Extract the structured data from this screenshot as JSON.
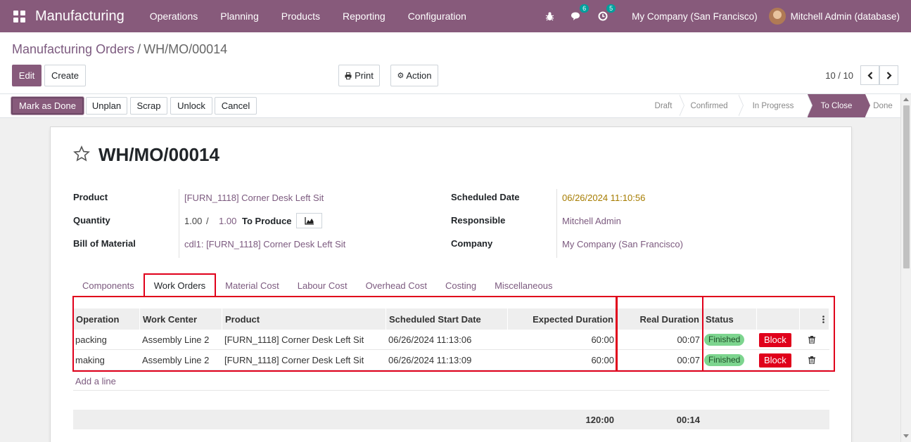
{
  "navbar": {
    "app_name": "Manufacturing",
    "menu": [
      "Operations",
      "Planning",
      "Products",
      "Reporting",
      "Configuration"
    ],
    "messages_count": "6",
    "activities_count": "5",
    "company": "My Company (San Francisco)",
    "user": "Mitchell Admin (database)",
    "colors": {
      "brand": "#875a7b"
    }
  },
  "breadcrumb": {
    "parent": "Manufacturing Orders",
    "separator": "/",
    "current": "WH/MO/00014"
  },
  "toolbar": {
    "edit": "Edit",
    "create": "Create",
    "print": "Print",
    "action": "Action"
  },
  "pager": {
    "text": "10 / 10"
  },
  "statusbar": {
    "buttons": [
      "Mark as Done",
      "Unplan",
      "Scrap",
      "Unlock",
      "Cancel"
    ],
    "stages": [
      "Draft",
      "Confirmed",
      "In Progress",
      "To Close",
      "Done"
    ],
    "active_stage": "To Close"
  },
  "form": {
    "title": "WH/MO/00014",
    "product_label": "Product",
    "product": "[FURN_1118] Corner Desk Left Sit",
    "quantity_label": "Quantity",
    "qty_produced": "1.00",
    "qty_sep": "/",
    "qty_total": "1.00",
    "qty_suffix": "To Produce",
    "bom_label": "Bill of Material",
    "bom": "cdl1: [FURN_1118] Corner Desk Left Sit",
    "scheduled_label": "Scheduled Date",
    "scheduled": "06/26/2024 11:10:56",
    "responsible_label": "Responsible",
    "responsible": "Mitchell Admin",
    "company_label": "Company",
    "company": "My Company (San Francisco)"
  },
  "tabs": [
    "Components",
    "Work Orders",
    "Material Cost",
    "Labour Cost",
    "Overhead Cost",
    "Costing",
    "Miscellaneous"
  ],
  "active_tab": "Work Orders",
  "table": {
    "headers": [
      "Operation",
      "Work Center",
      "Product",
      "Scheduled Start Date",
      "Expected Duration",
      "Real Duration",
      "Status"
    ],
    "rows": [
      {
        "operation": "packing",
        "work_center": "Assembly Line 2",
        "product": "[FURN_1118] Corner Desk Left Sit",
        "start": "06/26/2024 11:13:06",
        "expected": "60:00",
        "real": "00:07",
        "status": "Finished",
        "action": "Block"
      },
      {
        "operation": "making",
        "work_center": "Assembly Line 2",
        "product": "[FURN_1118] Corner Desk Left Sit",
        "start": "06/26/2024 11:13:09",
        "expected": "60:00",
        "real": "00:07",
        "status": "Finished",
        "action": "Block"
      }
    ],
    "add_line": "Add a line",
    "totals": {
      "expected": "120:00",
      "real": "00:14"
    }
  }
}
